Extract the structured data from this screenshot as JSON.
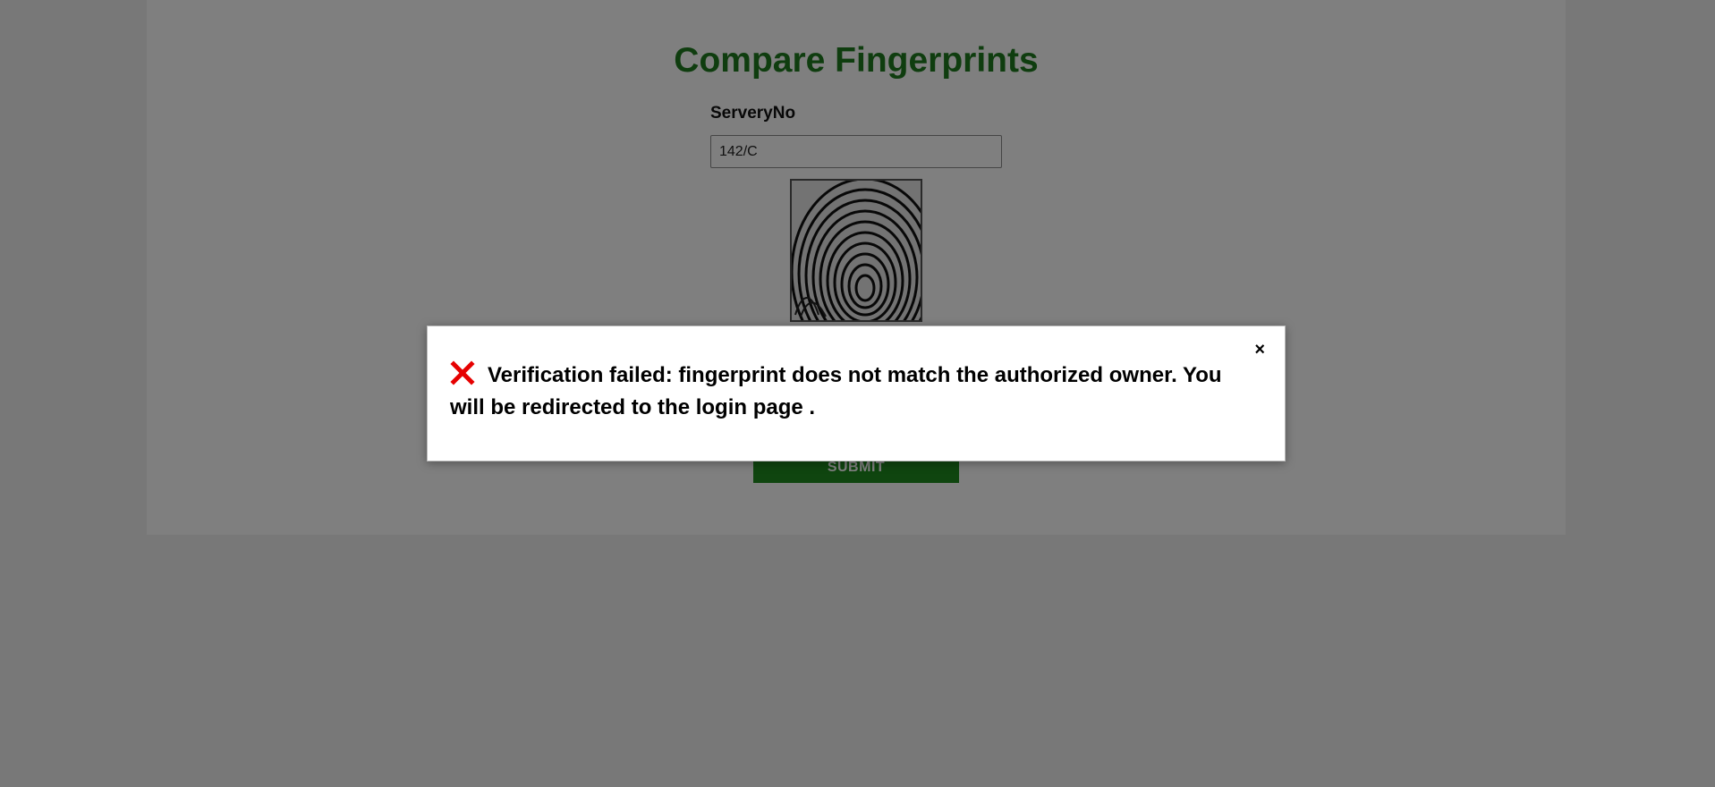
{
  "page": {
    "title": "Compare Fingerprints"
  },
  "form": {
    "serial_label": "ServeryNo",
    "serial_value": "142/C",
    "submit_label": "SUBMIT"
  },
  "modal": {
    "close_symbol": "×",
    "icon": "error-x-icon",
    "message": "Verification failed: fingerprint does not match the authorized owner. You will be redirected to the login page ."
  },
  "colors": {
    "accent_green": "#1e7a1e",
    "error_red": "#e60000"
  }
}
